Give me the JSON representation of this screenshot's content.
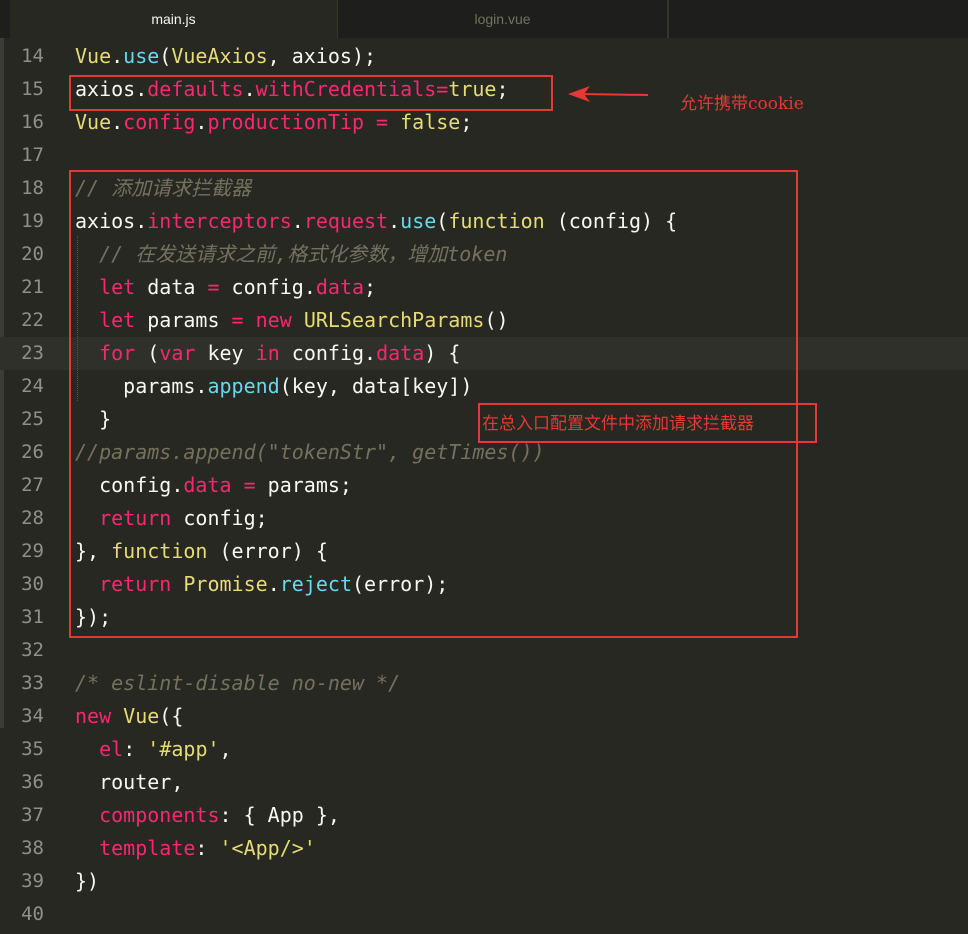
{
  "tabs": [
    {
      "label": "main.js",
      "active": true
    },
    {
      "label": "login.vue",
      "active": false
    }
  ],
  "lines": [
    {
      "n": "14",
      "tokens": [
        [
          "Vue",
          "type"
        ],
        [
          ".",
          "id"
        ],
        [
          "use",
          "fn"
        ],
        [
          "(",
          "id"
        ],
        [
          "VueAxios",
          "type"
        ],
        [
          ", axios);",
          "id"
        ]
      ]
    },
    {
      "n": "15",
      "tokens": [
        [
          "axios",
          "id"
        ],
        [
          ".",
          "id"
        ],
        [
          "defaults",
          "key"
        ],
        [
          ".",
          "id"
        ],
        [
          "withCredentials",
          "key"
        ],
        [
          "=",
          "key"
        ],
        [
          "true",
          "type"
        ],
        [
          ";",
          "id"
        ]
      ]
    },
    {
      "n": "16",
      "tokens": [
        [
          "Vue",
          "type"
        ],
        [
          ".",
          "id"
        ],
        [
          "config",
          "key"
        ],
        [
          ".",
          "id"
        ],
        [
          "productionTip",
          "key"
        ],
        [
          " = ",
          "key"
        ],
        [
          "false",
          "type"
        ],
        [
          ";",
          "id"
        ]
      ]
    },
    {
      "n": "17",
      "tokens": []
    },
    {
      "n": "18",
      "tokens": [
        [
          "// 添加请求拦截器",
          "cmt"
        ]
      ]
    },
    {
      "n": "19",
      "tokens": [
        [
          "axios",
          "id"
        ],
        [
          ".",
          "id"
        ],
        [
          "interceptors",
          "key"
        ],
        [
          ".",
          "id"
        ],
        [
          "request",
          "key"
        ],
        [
          ".",
          "id"
        ],
        [
          "use",
          "fn"
        ],
        [
          "(",
          "id"
        ],
        [
          "function",
          "type"
        ],
        [
          " (config) {",
          "id"
        ]
      ]
    },
    {
      "n": "20",
      "tokens": [
        [
          "  ",
          "id"
        ],
        [
          "// 在发送请求之前,格式化参数，增加token",
          "cmt"
        ]
      ]
    },
    {
      "n": "21",
      "tokens": [
        [
          "  ",
          "id"
        ],
        [
          "let",
          "key"
        ],
        [
          " data ",
          "id"
        ],
        [
          "=",
          "key"
        ],
        [
          " config",
          "id"
        ],
        [
          ".",
          "id"
        ],
        [
          "data",
          "key"
        ],
        [
          ";",
          "id"
        ]
      ]
    },
    {
      "n": "22",
      "tokens": [
        [
          "  ",
          "id"
        ],
        [
          "let",
          "key"
        ],
        [
          " params ",
          "id"
        ],
        [
          "=",
          "key"
        ],
        [
          " ",
          "id"
        ],
        [
          "new",
          "key"
        ],
        [
          " ",
          "id"
        ],
        [
          "URLSearchParams",
          "type"
        ],
        [
          "()",
          "id"
        ]
      ]
    },
    {
      "n": "23",
      "current": true,
      "tokens": [
        [
          "  ",
          "id"
        ],
        [
          "for",
          "key"
        ],
        [
          " (",
          "id"
        ],
        [
          "var",
          "key"
        ],
        [
          " key ",
          "id"
        ],
        [
          "in",
          "key"
        ],
        [
          " config",
          "id"
        ],
        [
          ".",
          "id"
        ],
        [
          "data",
          "key"
        ],
        [
          ") {",
          "id"
        ]
      ]
    },
    {
      "n": "24",
      "tokens": [
        [
          "    params",
          "id"
        ],
        [
          ".",
          "id"
        ],
        [
          "append",
          "fn"
        ],
        [
          "(key, data[key])",
          "id"
        ]
      ]
    },
    {
      "n": "25",
      "tokens": [
        [
          "  }",
          "id"
        ]
      ]
    },
    {
      "n": "26",
      "tokens": [
        [
          "//params.append(\"tokenStr\", getTimes())",
          "cmt"
        ]
      ]
    },
    {
      "n": "27",
      "tokens": [
        [
          "  config",
          "id"
        ],
        [
          ".",
          "id"
        ],
        [
          "data",
          "key"
        ],
        [
          " ",
          "id"
        ],
        [
          "=",
          "key"
        ],
        [
          " params;",
          "id"
        ]
      ]
    },
    {
      "n": "28",
      "tokens": [
        [
          "  ",
          "id"
        ],
        [
          "return",
          "key"
        ],
        [
          " config;",
          "id"
        ]
      ]
    },
    {
      "n": "29",
      "tokens": [
        [
          "}, ",
          "id"
        ],
        [
          "function",
          "type"
        ],
        [
          " (error) {",
          "id"
        ]
      ]
    },
    {
      "n": "30",
      "tokens": [
        [
          "  ",
          "id"
        ],
        [
          "return",
          "key"
        ],
        [
          " ",
          "id"
        ],
        [
          "Promise",
          "type"
        ],
        [
          ".",
          "id"
        ],
        [
          "reject",
          "fn"
        ],
        [
          "(error);",
          "id"
        ]
      ]
    },
    {
      "n": "31",
      "tokens": [
        [
          "});",
          "id"
        ]
      ]
    },
    {
      "n": "32",
      "tokens": []
    },
    {
      "n": "33",
      "tokens": [
        [
          "/* eslint-disable no-new */",
          "cmt"
        ]
      ]
    },
    {
      "n": "34",
      "tokens": [
        [
          "new",
          "key"
        ],
        [
          " ",
          "id"
        ],
        [
          "Vue",
          "type"
        ],
        [
          "({",
          "id"
        ]
      ]
    },
    {
      "n": "35",
      "tokens": [
        [
          "  ",
          "id"
        ],
        [
          "el",
          "key"
        ],
        [
          ": ",
          "id"
        ],
        [
          "'#app'",
          "str"
        ],
        [
          ",",
          "id"
        ]
      ]
    },
    {
      "n": "36",
      "tokens": [
        [
          "  router,",
          "id"
        ]
      ]
    },
    {
      "n": "37",
      "tokens": [
        [
          "  ",
          "id"
        ],
        [
          "components",
          "key"
        ],
        [
          ": { App },",
          "id"
        ]
      ]
    },
    {
      "n": "38",
      "tokens": [
        [
          "  ",
          "id"
        ],
        [
          "template",
          "key"
        ],
        [
          ": ",
          "id"
        ],
        [
          "'<App/>'",
          "str"
        ]
      ]
    },
    {
      "n": "39",
      "tokens": [
        [
          "})",
          "id"
        ]
      ]
    },
    {
      "n": "40",
      "tokens": []
    }
  ],
  "annotations": {
    "credentials_note": "允许携带cookie",
    "interceptor_note": "在总入口配置文件中添加请求拦截器"
  },
  "colors": {
    "annotation": "#e53935",
    "background": "#272822"
  }
}
